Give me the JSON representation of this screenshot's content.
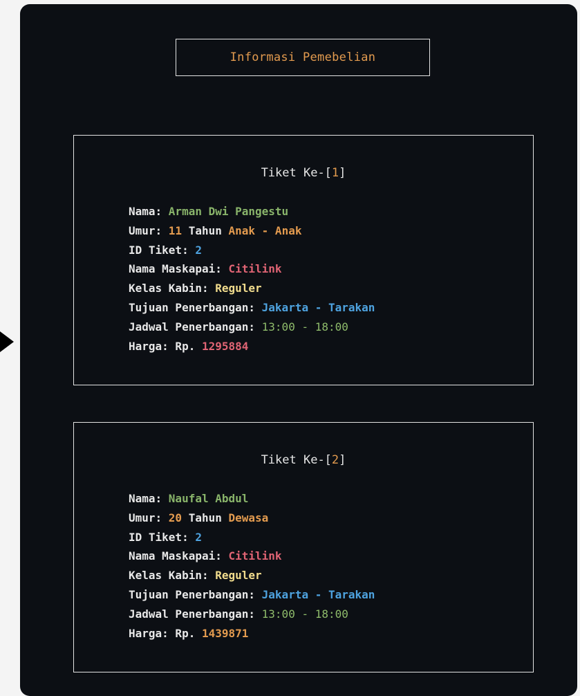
{
  "header": {
    "title": "Informasi Pemebelian"
  },
  "labels": {
    "ticket_prefix": "Tiket Ke-[",
    "ticket_suffix": "]",
    "nama": "Nama: ",
    "umur": "Umur: ",
    "tahun": " Tahun ",
    "id": "ID Tiket: ",
    "maskapai": "Nama Maskapai: ",
    "kelas": "Kelas Kabin: ",
    "tujuan": "Tujuan Penerbangan: ",
    "jadwal": "Jadwal Penerbangan: ",
    "harga": "Harga: Rp. "
  },
  "tickets": [
    {
      "number": "1",
      "nama": "Arman Dwi Pangestu",
      "umur": "11",
      "kategori": "Anak - Anak",
      "id": "2",
      "maskapai": "Citilink",
      "kelas": "Reguler",
      "tujuan": "Jakarta - Tarakan",
      "jadwal": "13:00 - 18:00",
      "harga": "1295884",
      "harga_color": "#e06474"
    },
    {
      "number": "2",
      "nama": "Naufal Abdul",
      "umur": "20",
      "kategori": "Dewasa",
      "id": "2",
      "maskapai": "Citilink",
      "kelas": "Reguler",
      "tujuan": "Jakarta - Tarakan",
      "jadwal": "13:00 - 18:00",
      "harga": "1439871",
      "harga_color": "#e39b4f"
    }
  ],
  "colors": {
    "background": "#0c0f14",
    "green": "#89b46a",
    "orange": "#e39b4f",
    "blue": "#4ea3e0",
    "red": "#e06474",
    "yellow": "#f1dc8d"
  },
  "icons": {
    "pointer": "triangle-right-icon"
  }
}
